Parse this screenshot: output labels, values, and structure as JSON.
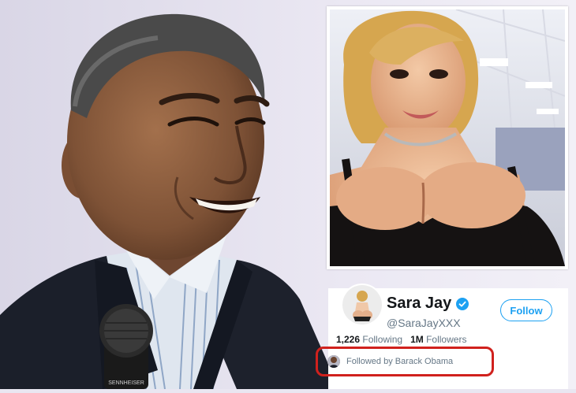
{
  "profile": {
    "display_name": "Sara Jay",
    "handle": "@SaraJayXXX",
    "follow_label": "Follow",
    "stats": [
      {
        "value": "1,226",
        "label": "Following"
      },
      {
        "value": "1M",
        "label": "Followers"
      }
    ],
    "followed_by": "Followed by Barack Obama",
    "verified_color": "#1da1f2",
    "highlight_color": "#d0211d"
  },
  "microphone": {
    "brand_text": "SENNHEISER"
  }
}
